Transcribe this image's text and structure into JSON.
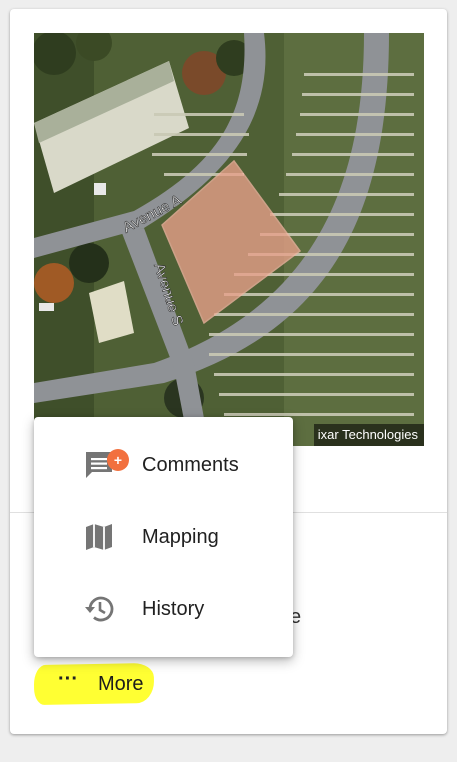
{
  "map": {
    "attribution": "ixar Technologies",
    "street_labels": [
      "Avenue A",
      "Avenue S"
    ]
  },
  "background_text": "e",
  "more": {
    "label": "More",
    "icon": "more-horizontal-icon",
    "highlight_color": "#ffff33"
  },
  "menu": {
    "items": [
      {
        "label": "Comments",
        "icon": "comment-icon",
        "badge": "+"
      },
      {
        "label": "Mapping",
        "icon": "map-icon"
      },
      {
        "label": "History",
        "icon": "history-icon"
      }
    ]
  },
  "colors": {
    "badge": "#f2703e",
    "icon": "#757575",
    "plot_highlight": "#e8a08a"
  }
}
